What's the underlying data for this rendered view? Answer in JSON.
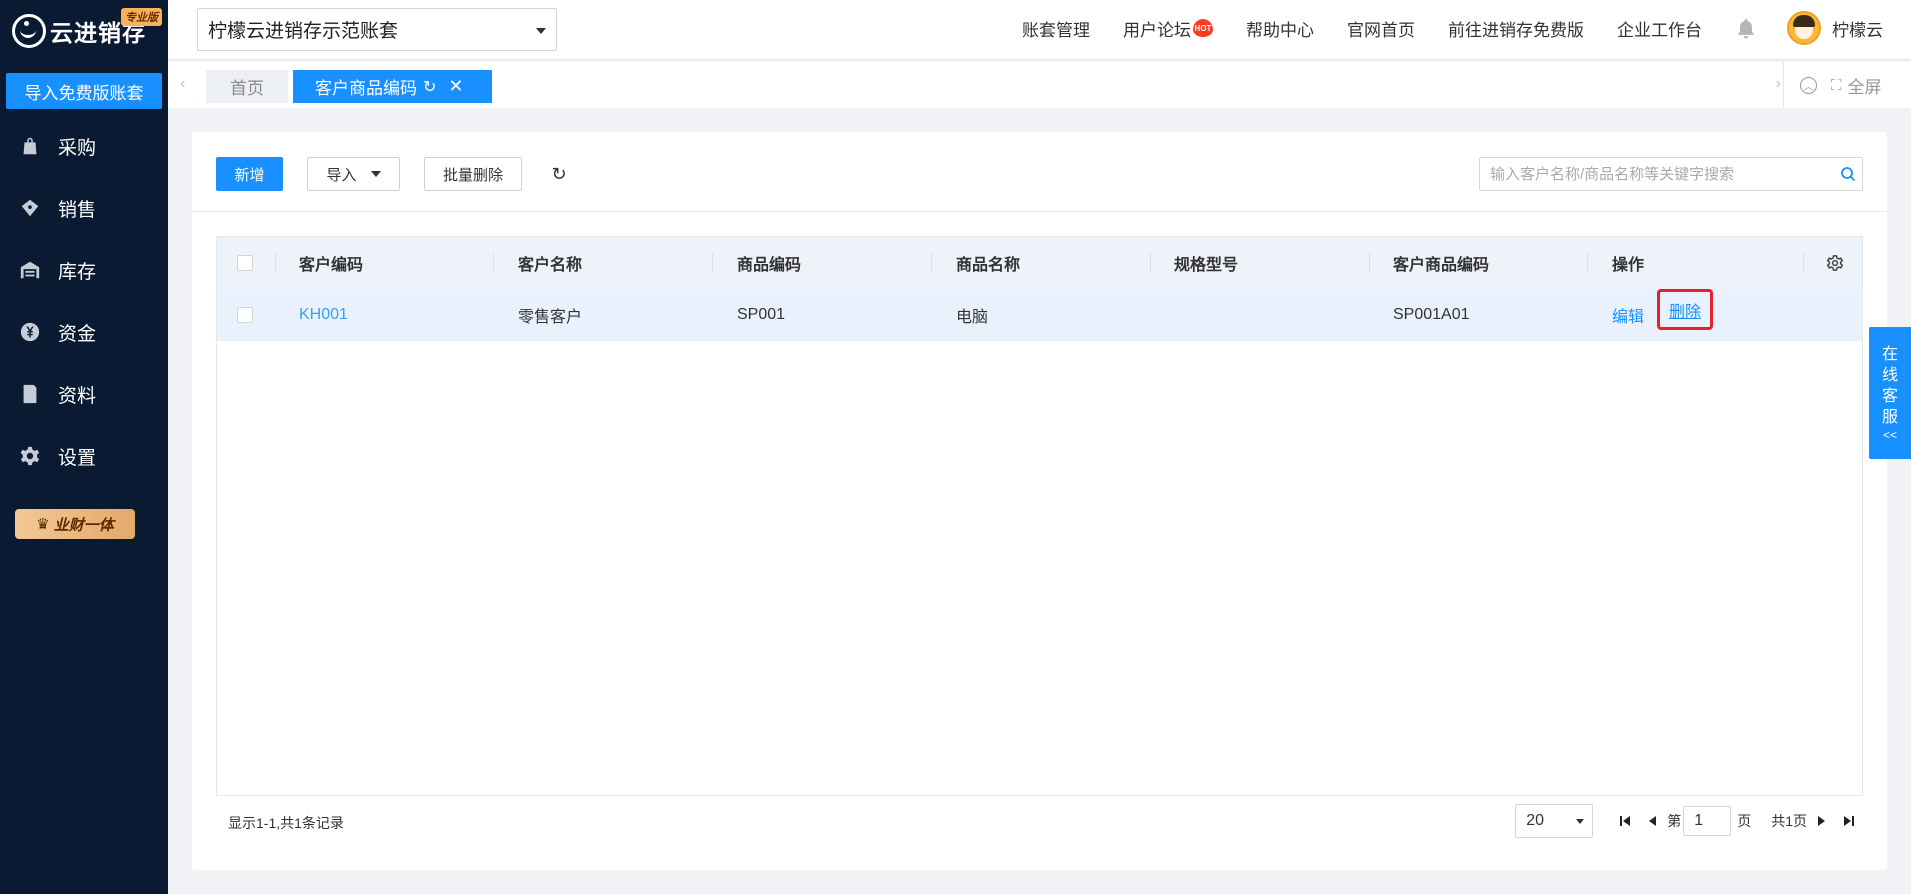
{
  "brand": {
    "name": "云进销存",
    "edition": "专业版"
  },
  "sidebar": {
    "import_button": "导入免费版账套",
    "items": [
      {
        "label": "采购",
        "icon": "shopping-bag-icon"
      },
      {
        "label": "销售",
        "icon": "sales-tag-icon"
      },
      {
        "label": "库存",
        "icon": "warehouse-icon"
      },
      {
        "label": "资金",
        "icon": "yen-coin-icon"
      },
      {
        "label": "资料",
        "icon": "document-icon"
      },
      {
        "label": "设置",
        "icon": "gear-icon"
      }
    ],
    "promo": "业财一体"
  },
  "header": {
    "account": "柠檬云进销存示范账套",
    "nav": [
      "账套管理",
      "用户论坛",
      "帮助中心",
      "官网首页",
      "前往进销存免费版",
      "企业工作台"
    ],
    "hot_badge": "HOT",
    "user": "柠檬云"
  },
  "tabs": {
    "home": "首页",
    "active": "客户商品编码",
    "fullscreen": "全屏"
  },
  "toolbar": {
    "add": "新增",
    "import": "导入",
    "batch_delete": "批量删除",
    "search_placeholder": "输入客户名称/商品名称等关键字搜索"
  },
  "table": {
    "columns": [
      "客户编码",
      "客户名称",
      "商品编码",
      "商品名称",
      "规格型号",
      "客户商品编码",
      "操作"
    ],
    "rows": [
      {
        "customer_code": "KH001",
        "customer_name": "零售客户",
        "goods_code": "SP001",
        "goods_name": "电脑",
        "spec": "",
        "customer_goods_code": "SP001A01",
        "edit": "编辑",
        "delete": "删除"
      }
    ]
  },
  "pager": {
    "summary": "显示1-1,共1条记录",
    "page_size": "20",
    "page_prefix": "第",
    "current_page": "1",
    "page_suffix": "页",
    "total_pages": "共1页"
  },
  "online_service": {
    "chars": [
      "在",
      "线",
      "客",
      "服"
    ],
    "arrow": "<<"
  },
  "colors": {
    "primary": "#1890ff",
    "sidebar": "#0a1a32",
    "highlight_border": "#e8202a"
  }
}
